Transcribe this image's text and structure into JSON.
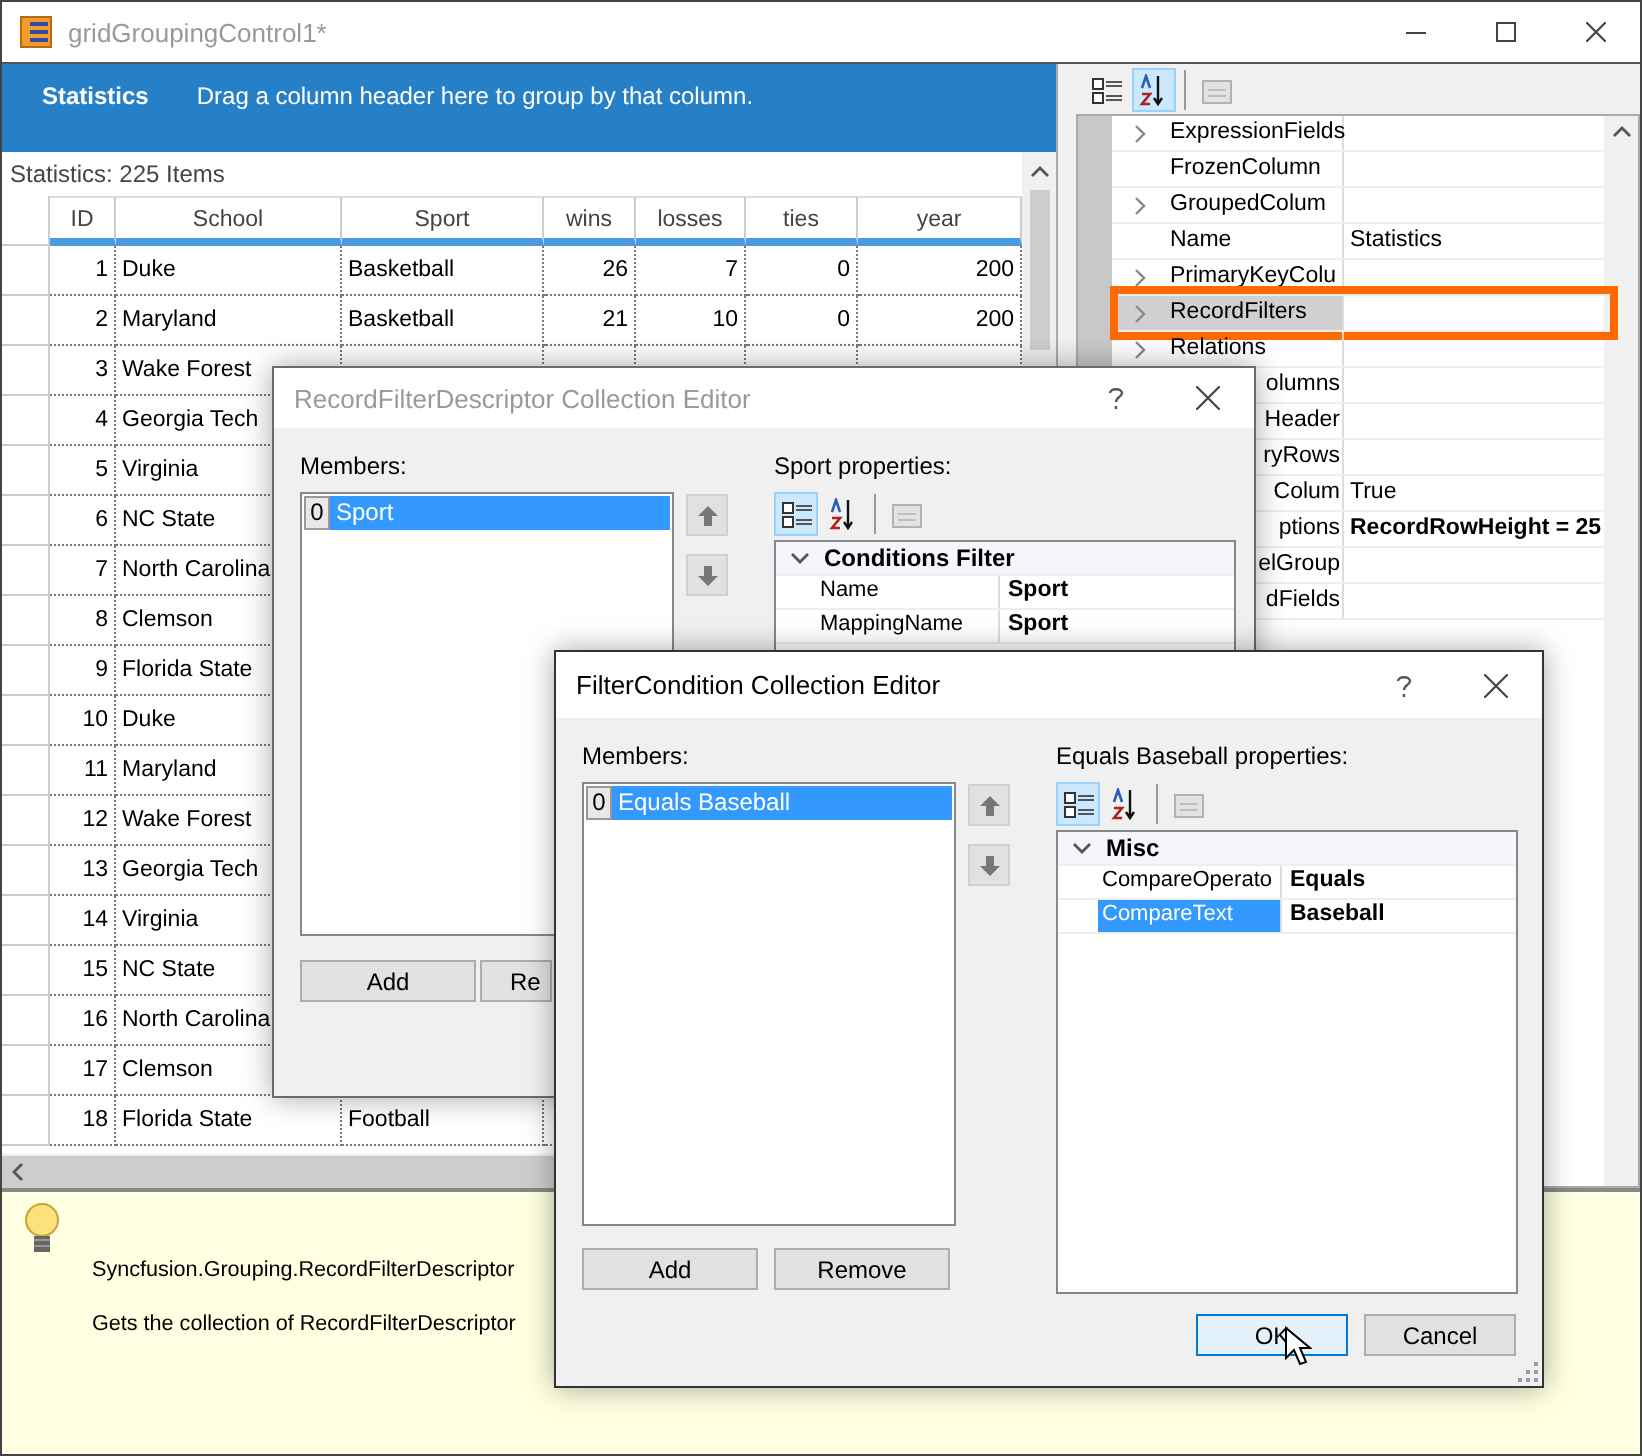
{
  "window": {
    "title": "gridGroupingControl1*"
  },
  "group_drop_area": {
    "table_name": "Statistics",
    "hint": "Drag a column header here to group by that column."
  },
  "grid": {
    "caption": "Statistics: 225 Items",
    "columns": [
      {
        "title": "ID"
      },
      {
        "title": "School"
      },
      {
        "title": "Sport"
      },
      {
        "title": "wins"
      },
      {
        "title": "losses"
      },
      {
        "title": "ties"
      },
      {
        "title": "year"
      }
    ],
    "rows": [
      [
        "1",
        "Duke",
        "Basketball",
        "26",
        "7",
        "0",
        "200"
      ],
      [
        "2",
        "Maryland",
        "Basketball",
        "21",
        "10",
        "0",
        "200"
      ],
      [
        "3",
        "Wake Forest"
      ],
      [
        "4",
        "Georgia Tech"
      ],
      [
        "5",
        "Virginia"
      ],
      [
        "6",
        "NC State"
      ],
      [
        "7",
        "North Carolina"
      ],
      [
        "8",
        "Clemson"
      ],
      [
        "9",
        "Florida State"
      ],
      [
        "10",
        "Duke"
      ],
      [
        "11",
        "Maryland"
      ],
      [
        "12",
        "Wake Forest"
      ],
      [
        "13",
        "Georgia Tech"
      ],
      [
        "14",
        "Virginia"
      ],
      [
        "15",
        "NC State"
      ],
      [
        "16",
        "North Carolina"
      ],
      [
        "17",
        "Clemson"
      ],
      [
        "18",
        "Florida State",
        "Football"
      ]
    ]
  },
  "property_grid": {
    "toolbar": [
      {
        "kind": "categorized",
        "selected": false,
        "disabled": false
      },
      {
        "kind": "alphabetical",
        "selected": true,
        "disabled": false
      },
      {
        "kind": "property_pages",
        "selected": false,
        "disabled": true
      }
    ],
    "properties": [
      {
        "kind": "full",
        "name": "ExpressionFields",
        "expandable": true,
        "highlighted": false
      },
      {
        "kind": "full",
        "name": "FrozenColumn",
        "expandable": false,
        "highlighted": false
      },
      {
        "kind": "full",
        "name": "GroupedColum",
        "expandable": true,
        "highlighted": false
      },
      {
        "kind": "full",
        "name": "Name",
        "value": "Statistics",
        "expandable": false,
        "highlighted": false,
        "bold": false
      },
      {
        "kind": "full",
        "name": "PrimaryKeyColu",
        "expandable": true,
        "highlighted": false
      },
      {
        "kind": "full",
        "name": "RecordFilters",
        "expandable": true,
        "highlighted": true
      },
      {
        "kind": "full",
        "name": "Relations",
        "expandable": true,
        "highlighted": false
      },
      {
        "kind": "partial",
        "name": "olumns",
        "highlighted": false
      },
      {
        "kind": "partial",
        "name": "Header",
        "highlighted": false
      },
      {
        "kind": "partial",
        "name": "ryRows",
        "highlighted": false
      },
      {
        "kind": "partial",
        "name": "Colum",
        "value": "True",
        "highlighted": false,
        "bold": false
      },
      {
        "kind": "partial",
        "name": "ptions",
        "value": "RecordRowHeight = 25",
        "highlighted": false,
        "bold": true
      },
      {
        "kind": "partial",
        "name": "elGroup",
        "highlighted": false
      },
      {
        "kind": "partial",
        "name": "dFields",
        "highlighted": false
      }
    ]
  },
  "help_panel": {
    "type_name": "Syncfusion.Grouping.RecordFilterDescriptor",
    "description": "Gets the collection of RecordFilterDescriptor"
  },
  "dialogs": [
    {
      "title": "RecordFilterDescriptor Collection Editor",
      "active": false,
      "members_label": "Members:",
      "members": [
        {
          "index": "0",
          "label": "Sport",
          "selected": true
        }
      ],
      "properties_label": "Sport properties:",
      "toolbar": [
        {
          "kind": "categorized",
          "selected": true,
          "disabled": false
        },
        {
          "kind": "alphabetical",
          "selected": false,
          "disabled": false
        },
        {
          "kind": "property_pages",
          "selected": false,
          "disabled": true
        }
      ],
      "properties": [
        {
          "kind": "category",
          "name": "Conditions Filter",
          "expanded": true
        },
        {
          "kind": "property",
          "name": "Name",
          "value": "Sport",
          "bold": true,
          "selected": false
        },
        {
          "kind": "property",
          "name": "MappingName",
          "value": "Sport",
          "bold": true,
          "selected": false
        }
      ],
      "buttons": [
        {
          "label": "Add",
          "cut": false
        },
        {
          "label": "Re",
          "cut": true
        }
      ]
    },
    {
      "title": "FilterCondition Collection Editor",
      "active": true,
      "members_label": "Members:",
      "members": [
        {
          "index": "0",
          "label": "Equals Baseball",
          "selected": true
        }
      ],
      "properties_label": "Equals Baseball properties:",
      "toolbar": [
        {
          "kind": "categorized",
          "selected": true,
          "disabled": false
        },
        {
          "kind": "alphabetical",
          "selected": false,
          "disabled": false
        },
        {
          "kind": "property_pages",
          "selected": false,
          "disabled": true
        }
      ],
      "properties": [
        {
          "kind": "category",
          "name": "Misc",
          "expanded": true
        },
        {
          "kind": "property",
          "name": "CompareOperato",
          "value": "Equals",
          "bold": true,
          "selected": false
        },
        {
          "kind": "property",
          "name": "CompareText",
          "value": "Baseball",
          "bold": true,
          "selected": true
        }
      ],
      "buttons": [
        {
          "label": "Add",
          "cut": false
        },
        {
          "label": "Remove",
          "cut": false
        }
      ],
      "footer_buttons": [
        {
          "label": "OK",
          "default": true
        },
        {
          "label": "Cancel",
          "default": false
        }
      ]
    }
  ]
}
